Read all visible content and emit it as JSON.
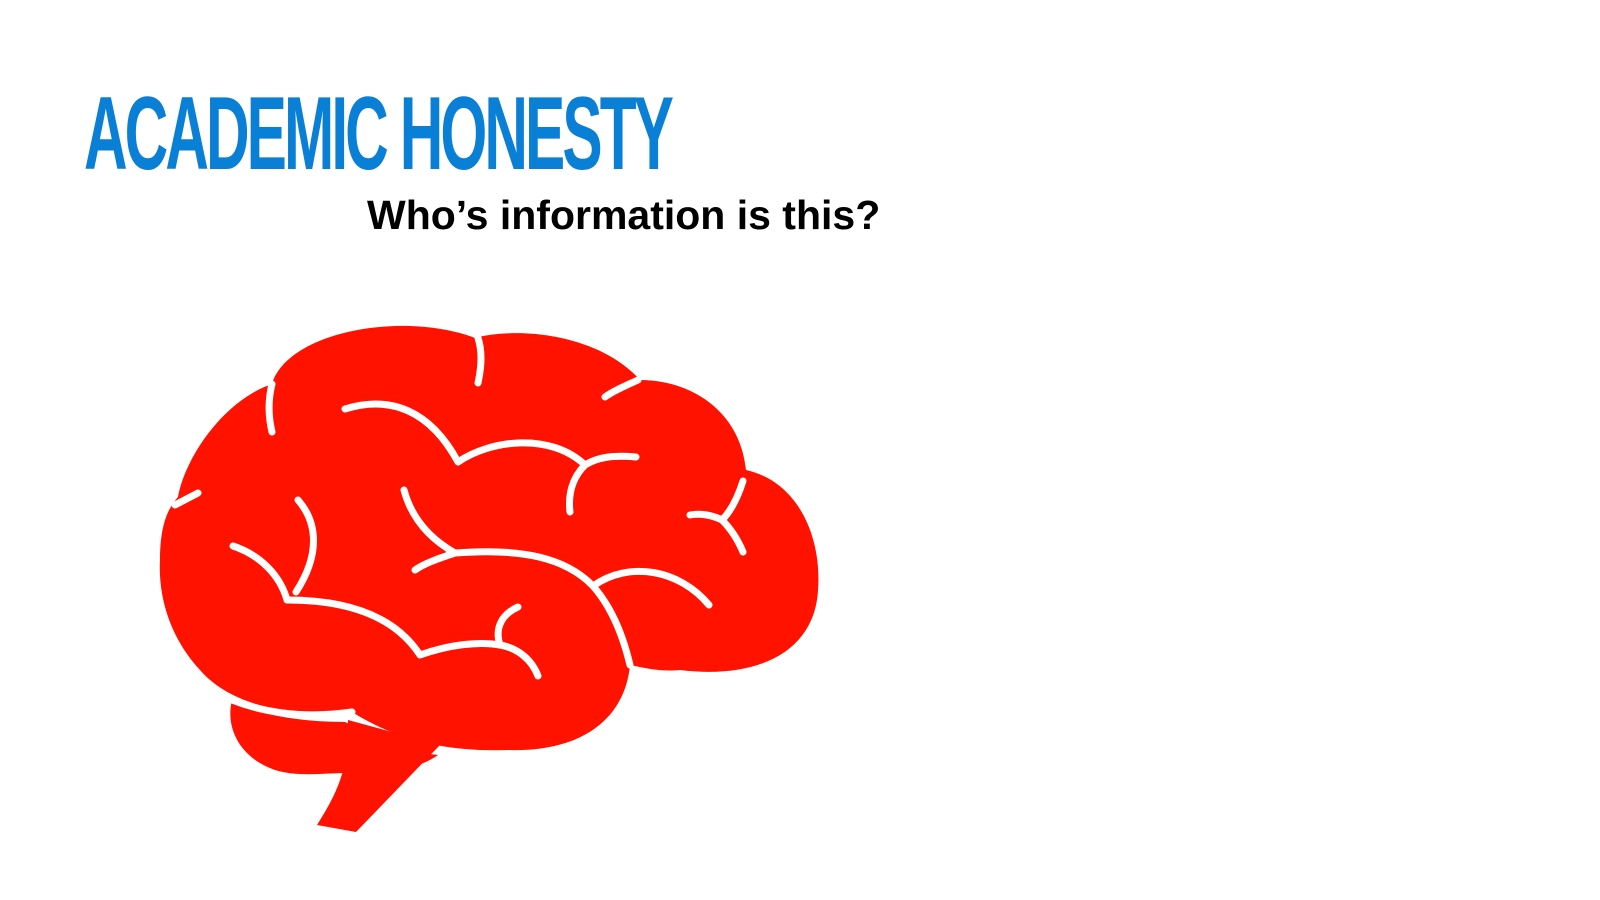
{
  "slide": {
    "title": "ACADEMIC HONESTY",
    "subtitle": "Who’s information is this?",
    "illustration": "brain-icon"
  },
  "colors": {
    "title": "#0a7fd6",
    "subtitle": "#000000",
    "brain": "#ff1200",
    "background": "#ffffff"
  }
}
